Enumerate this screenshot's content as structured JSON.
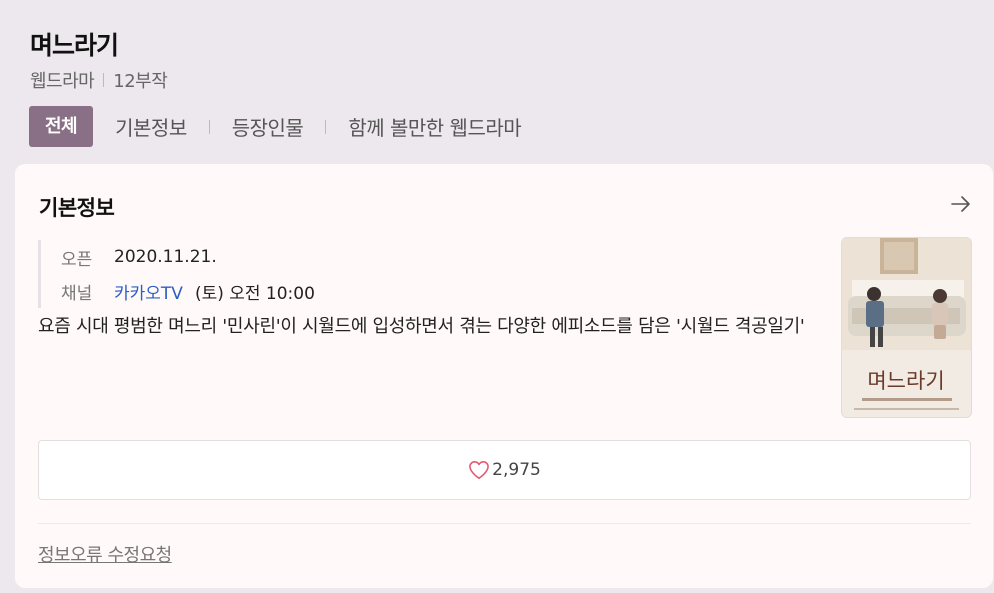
{
  "header": {
    "title": "며느라기",
    "genre": "웹드라마",
    "episodes": "12부작"
  },
  "tabs": [
    {
      "label": "전체",
      "active": true
    },
    {
      "label": "기본정보",
      "active": false
    },
    {
      "label": "등장인물",
      "active": false
    },
    {
      "label": "함께 볼만한 웹드라마",
      "active": false
    }
  ],
  "info": {
    "section_title": "기본정보",
    "open_label": "오픈",
    "open_date": "2020.11.21.",
    "channel_label": "채널",
    "channel_name": "카카오TV",
    "schedule": "(토) 오전 10:00",
    "description": "요즘 시대 평범한 며느리 '민사린'이 시월드에 입성하면서 겪는 다양한 에피소드를 담은 '시월드 격공일기'",
    "poster_title": "며느라기"
  },
  "like": {
    "count": "2,975",
    "icon": "heart-outline-icon",
    "color": "#e5566f"
  },
  "footer": {
    "report_label": "정보오류 수정요청"
  },
  "colors": {
    "background": "#ede8ee",
    "active_tab": "#8a7087",
    "channel_link": "#2a5fc4"
  }
}
